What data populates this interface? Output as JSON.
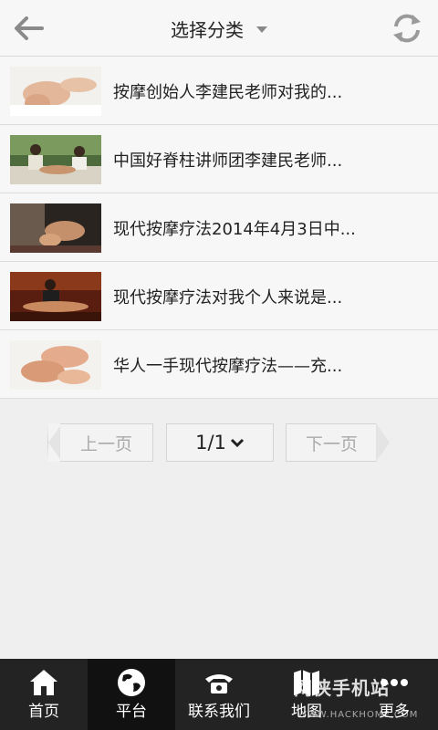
{
  "header": {
    "title": "选择分类"
  },
  "articles": [
    {
      "title": "按摩创始人李建民老师对我的..."
    },
    {
      "title": "中国好脊柱讲师团李建民老师..."
    },
    {
      "title": "现代按摩疗法2014年4月3日中..."
    },
    {
      "title": "现代按摩疗法对我个人来说是..."
    },
    {
      "title": "华人一手现代按摩疗法——充..."
    }
  ],
  "pager": {
    "prev_label": "上一页",
    "page_label": "1/1",
    "next_label": "下一页"
  },
  "tabs": [
    {
      "label": "首页",
      "icon": "home-icon"
    },
    {
      "label": "平台",
      "icon": "globe-icon"
    },
    {
      "label": "联系我们",
      "icon": "phone-icon"
    },
    {
      "label": "地图",
      "icon": "map-icon"
    },
    {
      "label": "更多",
      "icon": "more-icon"
    }
  ],
  "watermark": {
    "text": "网侠手机站",
    "url": "WWW.HACKHOME.COM"
  },
  "colors": {
    "header_bg": "#f7f7f7",
    "tabbar_bg": "#232323",
    "active_tab_bg": "#111111"
  }
}
